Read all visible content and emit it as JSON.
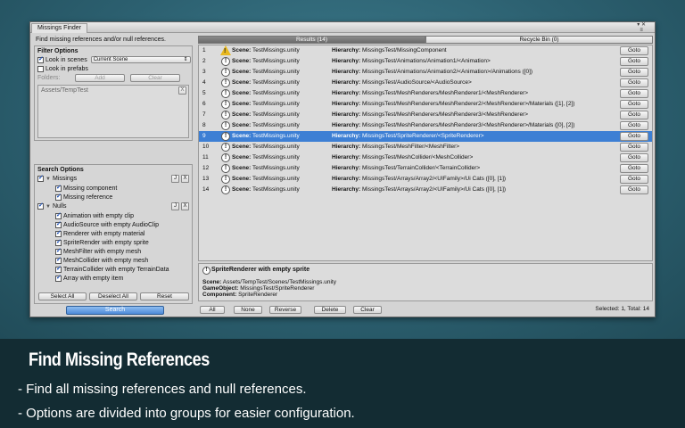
{
  "window": {
    "title": "Missings Finder",
    "ctrl_top": "▾ ✕",
    "ctrl_bottom": "≡"
  },
  "left": {
    "description": "Find missing references and/or null references.",
    "filter": {
      "title": "Filter Options",
      "look_in_scenes": "Look in scenes",
      "look_in_scenes_checked": true,
      "scene_select": "Current Scene",
      "look_in_prefabs": "Look in prefabs",
      "look_in_prefabs_checked": false,
      "folders_label": "Folders:",
      "add_label": "Add",
      "clear_label": "Clear",
      "folder_item": "Assets/TempTest",
      "remove_label": "X"
    },
    "search_options": {
      "title": "Search Options",
      "missings_group": {
        "label": "Missings",
        "checked": true,
        "items": [
          "Missing component",
          "Missing reference"
        ]
      },
      "nulls_group": {
        "label": "Nulls",
        "checked": true,
        "items": [
          "Animation with empty clip",
          "AudioSource with empty AudioClip",
          "Renderer with empty material",
          "SpriteRender with empty sprite",
          "MeshFilter with empty mesh",
          "MeshCollider with empty mesh",
          "TerrainCollider with empty TerrainData",
          "Array with empty item"
        ]
      },
      "mini_j": "J",
      "mini_x": "X",
      "select_all": "Select All",
      "deselect_all": "Deselect All",
      "reset": "Reset"
    },
    "search_label": "Search"
  },
  "right": {
    "tab_results": "Results (14)",
    "tab_recycle": "Recycle Bin (0)",
    "scene_key": "Scene:",
    "hier_key": "Hierarchy:",
    "goto_label": "Goto",
    "results": [
      {
        "num": "1",
        "icon": "warning-icon",
        "scene": "TestMissings.unity",
        "hierarchy": "MissingsTest/MissingComponent"
      },
      {
        "num": "2",
        "icon": "info-icon",
        "scene": "TestMissings.unity",
        "hierarchy": "MissingsTest/Animations/Animation1/<Animation>"
      },
      {
        "num": "3",
        "icon": "info-icon",
        "scene": "TestMissings.unity",
        "hierarchy": "MissingsTest/Animations/Animation2/<Animation>/Animations ([0])"
      },
      {
        "num": "4",
        "icon": "info-icon",
        "scene": "TestMissings.unity",
        "hierarchy": "MissingsTest/AudioSource/<AudioSource>"
      },
      {
        "num": "5",
        "icon": "info-icon",
        "scene": "TestMissings.unity",
        "hierarchy": "MissingsTest/MeshRenderers/MeshRenderer1/<MeshRenderer>"
      },
      {
        "num": "6",
        "icon": "info-icon",
        "scene": "TestMissings.unity",
        "hierarchy": "MissingsTest/MeshRenderers/MeshRenderer2/<MeshRenderer>/Materials ([1], [2])"
      },
      {
        "num": "7",
        "icon": "info-icon",
        "scene": "TestMissings.unity",
        "hierarchy": "MissingsTest/MeshRenderers/MeshRenderer3/<MeshRenderer>"
      },
      {
        "num": "8",
        "icon": "info-icon",
        "scene": "TestMissings.unity",
        "hierarchy": "MissingsTest/MeshRenderers/MeshRenderer3/<MeshRenderer>/Materials ([0], [2])"
      },
      {
        "num": "9",
        "icon": "info-icon",
        "scene": "TestMissings.unity",
        "hierarchy": "MissingsTest/SpriteRenderer/<SpriteRenderer>",
        "selected": true
      },
      {
        "num": "10",
        "icon": "info-icon",
        "scene": "TestMissings.unity",
        "hierarchy": "MissingsTest/MeshFilter/<MeshFilter>"
      },
      {
        "num": "11",
        "icon": "info-icon",
        "scene": "TestMissings.unity",
        "hierarchy": "MissingsTest/MeshCollider/<MeshCollider>"
      },
      {
        "num": "12",
        "icon": "info-icon",
        "scene": "TestMissings.unity",
        "hierarchy": "MissingsTest/TerrainCollider/<TerrainCollider>"
      },
      {
        "num": "13",
        "icon": "info-icon",
        "scene": "TestMissings.unity",
        "hierarchy": "MissingsTest/Arrays/Array2/<UIFamily>/Ui Cats ([0], [1])"
      },
      {
        "num": "14",
        "icon": "info-icon",
        "scene": "TestMissings.unity",
        "hierarchy": "MissingsTest/Arrays/Array2/<UIFamily>/Ui Cats ([0], [1])"
      }
    ],
    "detail": {
      "title": "SpriteRenderer with empty sprite",
      "scene_key": "Scene:",
      "scene_val": "Assets/TempTest/Scenes/TestMissings.unity",
      "go_key": "GameObject:",
      "go_val": "MissingsTest/SpriteRenderer",
      "comp_key": "Component:",
      "comp_val": "SpriteRenderer"
    },
    "bottom": {
      "all": "All",
      "none": "None",
      "reverse": "Reverse",
      "delete": "Delete",
      "clear": "Clear",
      "status": "Selected: 1, Total: 14"
    }
  },
  "promo": {
    "title": "Find Missing References",
    "line1": "- Find all missing references and null references.",
    "line2": "- Options are divided into groups for easier configuration."
  },
  "colors": {
    "selection": "#3d7fd4",
    "search_button": "#5a95dc",
    "warning": "#e8b81f",
    "background": "#2c5f6e"
  }
}
